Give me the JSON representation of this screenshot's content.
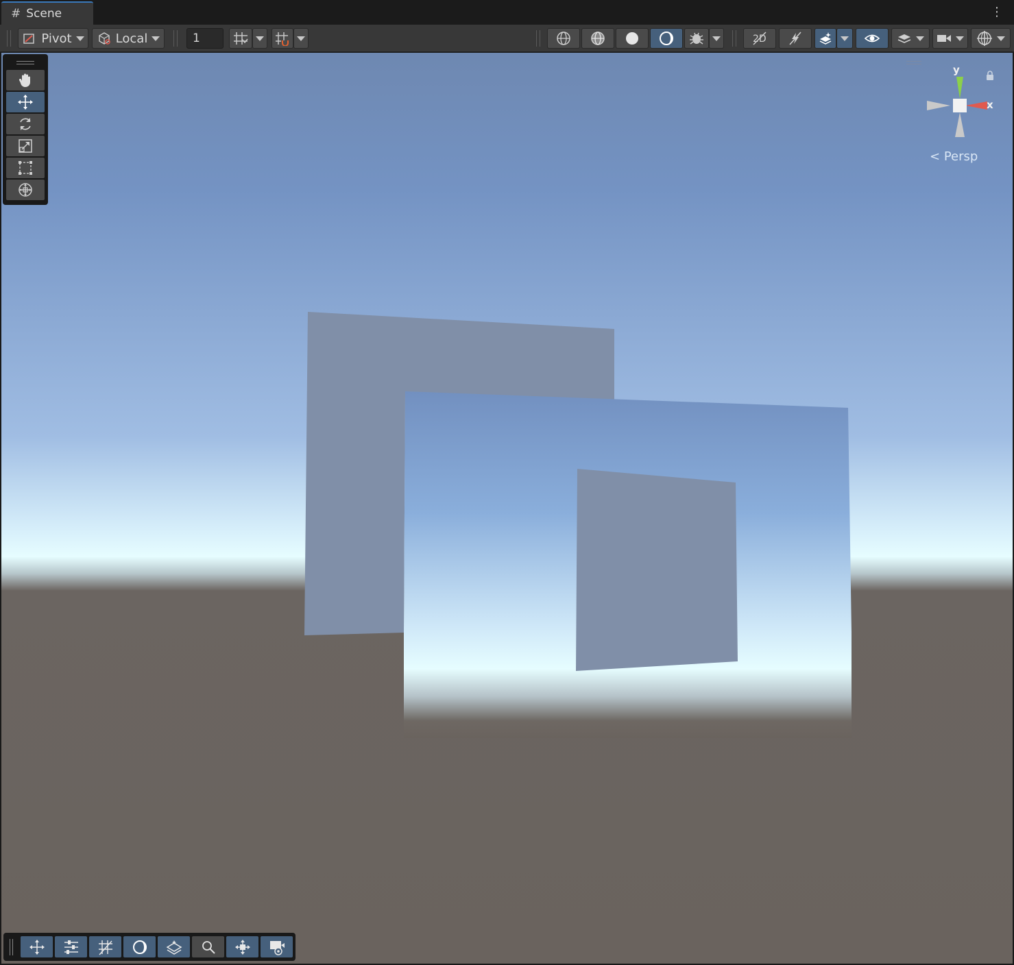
{
  "tab": {
    "title": "Scene",
    "icon": "hash-icon"
  },
  "toolbar": {
    "pivot_label": "Pivot",
    "local_label": "Local",
    "grid_snap_value": "1"
  },
  "gizmo": {
    "y_label": "y",
    "x_label": "x",
    "projection_label": "Persp"
  },
  "colors": {
    "accent": "#46607c",
    "tab_underline": "#3a79bb",
    "sky_top": "#6e88b1",
    "horizon": "#e6fdff",
    "ground": "#6a635e",
    "plane": "#808fa8",
    "gizmo_x": "#e05a4f",
    "gizmo_y": "#8cd04a"
  }
}
